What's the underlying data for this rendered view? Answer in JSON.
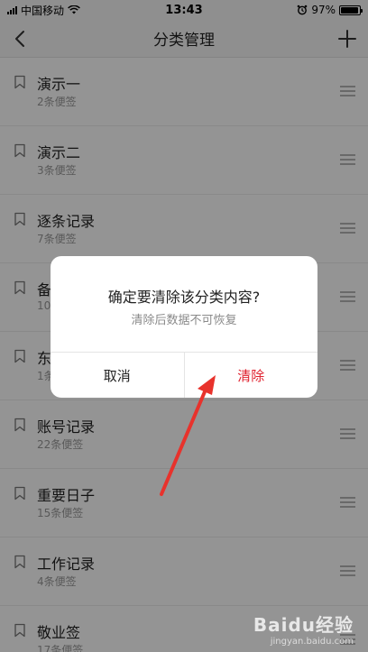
{
  "status_bar": {
    "carrier": "中国移动",
    "time": "13:43",
    "battery_percent": "97%",
    "battery_level": 0.97
  },
  "nav": {
    "title": "分类管理"
  },
  "categories": [
    {
      "name": "演示一",
      "count": "2条便签"
    },
    {
      "name": "演示二",
      "count": "3条便签"
    },
    {
      "name": "逐条记录",
      "count": "7条便签"
    },
    {
      "name": "备",
      "count": "10"
    },
    {
      "name": "东",
      "count": "1条"
    },
    {
      "name": "账号记录",
      "count": "22条便签"
    },
    {
      "name": "重要日子",
      "count": "15条便签"
    },
    {
      "name": "工作记录",
      "count": "4条便签"
    },
    {
      "name": "敬业签",
      "count": "17条便签"
    }
  ],
  "dialog": {
    "title": "确定要清除该分类内容?",
    "message": "清除后数据不可恢复",
    "cancel_label": "取消",
    "confirm_label": "清除"
  },
  "watermark": {
    "logo": "Baidu经验",
    "url": "jingyan.baidu.com"
  },
  "colors": {
    "confirm": "#e0212e",
    "arrow": "#e8322c",
    "mask": "rgba(0,0,0,0.42)"
  },
  "icons": [
    "back-icon",
    "add-icon",
    "bookmark-icon",
    "drag-handle-icon",
    "wifi-icon",
    "alarm-icon",
    "battery-icon"
  ]
}
